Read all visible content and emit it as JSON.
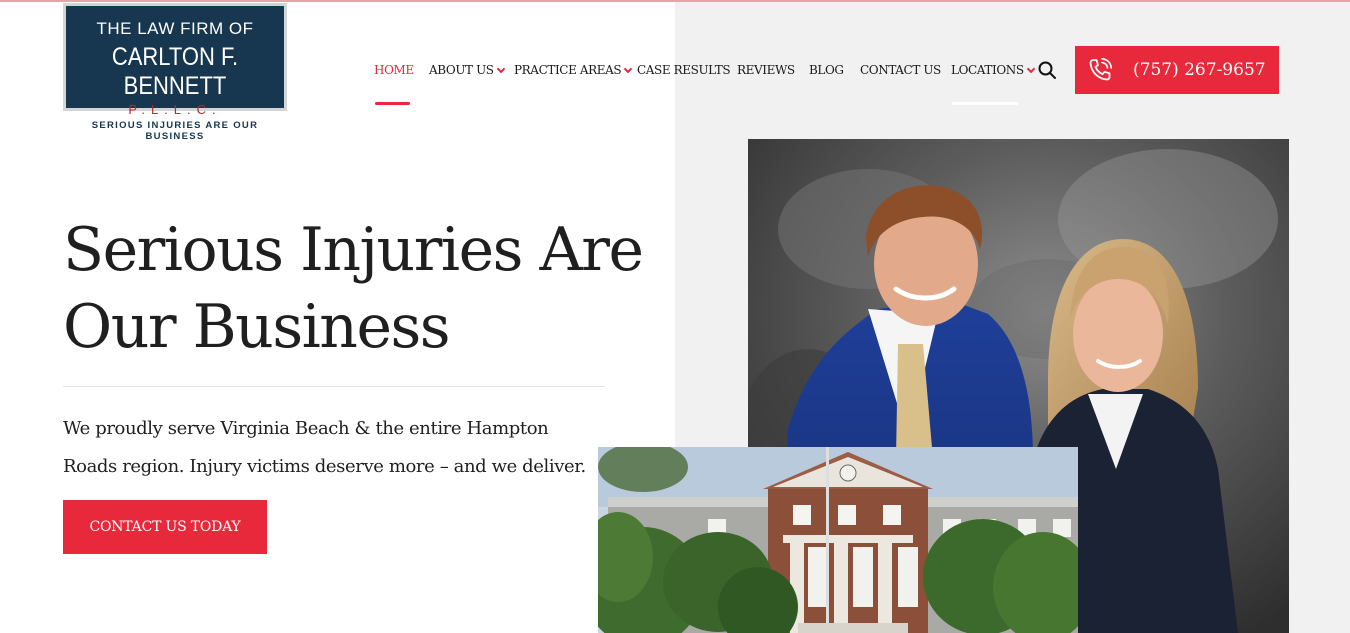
{
  "logo": {
    "line1": "THE LAW FIRM OF",
    "line2": "CARLTON F. BENNETT",
    "line3": "P.L.L.C.",
    "tagline": "SERIOUS INJURIES ARE OUR BUSINESS"
  },
  "nav": {
    "items": [
      {
        "label": "HOME",
        "active": true,
        "dropdown": false
      },
      {
        "label": "ABOUT US",
        "active": false,
        "dropdown": true
      },
      {
        "label": "PRACTICE AREAS",
        "active": false,
        "dropdown": true
      },
      {
        "label": "CASE RESULTS",
        "active": false,
        "dropdown": false
      },
      {
        "label": "REVIEWS",
        "active": false,
        "dropdown": false
      },
      {
        "label": "BLOG",
        "active": false,
        "dropdown": false
      },
      {
        "label": "CONTACT US",
        "active": false,
        "dropdown": false
      },
      {
        "label": "LOCATIONS",
        "active": false,
        "dropdown": true
      }
    ],
    "search_icon": "search-icon",
    "phone": {
      "icon": "phone-icon",
      "label": "(757) 267-9657"
    }
  },
  "hero": {
    "title_line1": "Serious Injuries Are",
    "title_line2": "Our Business",
    "text_line1": "We proudly serve Virginia Beach & the entire Hampton",
    "text_line2": "Roads region. Injury victims deserve more – and we deliver.",
    "cta_label": "CONTACT US TODAY"
  },
  "colors": {
    "accent": "#e8293c",
    "logo_navy": "#16374f",
    "text": "#1f1f1f"
  }
}
